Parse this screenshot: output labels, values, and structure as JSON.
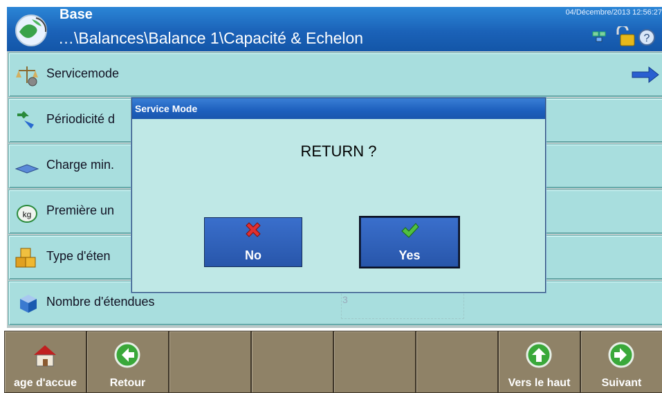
{
  "header": {
    "title": "Base",
    "path": "…\\Balances\\Balance 1\\Capacité & Echelon",
    "datetime": "04/Décembre/2013 12:56:27",
    "icons": [
      "network-icon",
      "lock-icon",
      "help-icon"
    ]
  },
  "rows": [
    {
      "label": "Servicemode",
      "icon": "scale-gear-icon"
    },
    {
      "label": "Périodicité d",
      "icon": "arrows-icon"
    },
    {
      "label": "Charge min.",
      "icon": "plate-icon"
    },
    {
      "label": "Première un",
      "icon": "kg-icon"
    },
    {
      "label": "Type d'éten",
      "icon": "boxes-icon"
    },
    {
      "label": "Nombre d'étendues",
      "icon": "cube-icon",
      "value": "3"
    }
  ],
  "dialog": {
    "title": "Service Mode",
    "message": "RETURN ?",
    "no_label": "No",
    "yes_label": "Yes"
  },
  "softkeys": [
    {
      "label": "age d'accue",
      "icon": "home-icon"
    },
    {
      "label": "Retour",
      "icon": "back-icon"
    },
    {
      "label": ""
    },
    {
      "label": ""
    },
    {
      "label": ""
    },
    {
      "label": ""
    },
    {
      "label": "Vers le haut",
      "icon": "up-icon"
    },
    {
      "label": "Suivant",
      "icon": "next-icon"
    }
  ],
  "colors": {
    "header": "#1b62b8",
    "row": "#a8dede",
    "dialog": "#bfe8e6",
    "softkey": "#8f8267"
  }
}
